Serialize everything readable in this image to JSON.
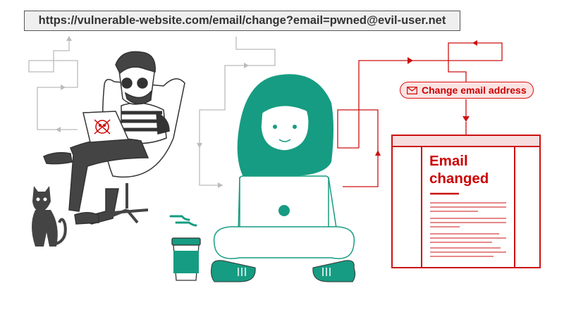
{
  "url_bar": {
    "text": "https://vulnerable-website.com/email/change?email=pwned@evil-user.net"
  },
  "action_pill": {
    "label": "Change email address",
    "icon": "envelope-icon"
  },
  "result_document": {
    "title_line1": "Email",
    "title_line2": "changed"
  },
  "colors": {
    "red": "#cc1111",
    "teal": "#169c82",
    "dark": "#444444",
    "gray": "#bbbbbb"
  }
}
